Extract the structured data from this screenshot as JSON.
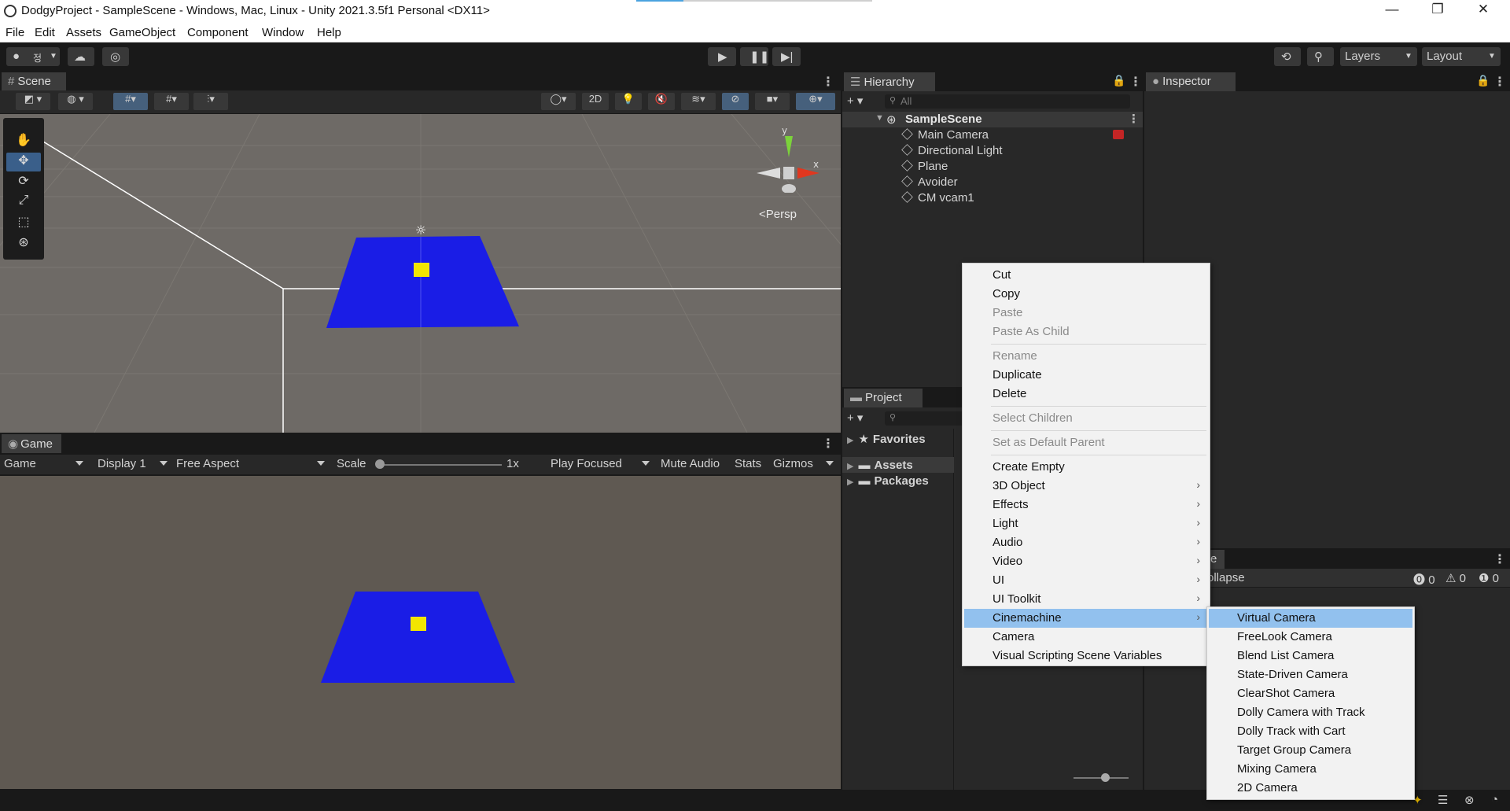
{
  "window": {
    "title": "DodgyProject - SampleScene - Windows, Mac, Linux - Unity 2021.3.5f1 Personal <DX11>",
    "minimize": "—",
    "restore": "❐",
    "close": "✕"
  },
  "menubar": [
    "File",
    "Edit",
    "Assets",
    "GameObject",
    "Component",
    "Window",
    "Help"
  ],
  "toolbar": {
    "account_glyph": "정",
    "layers": "Layers",
    "layout": "Layout"
  },
  "scene": {
    "tab": "Scene",
    "toggle_2d": "2D",
    "persp": "<Persp",
    "axis_x": "x",
    "axis_y": "y"
  },
  "game": {
    "tab": "Game",
    "mode": "Game",
    "display": "Display 1",
    "aspect": "Free Aspect",
    "scale_label": "Scale",
    "scale_value": "1x",
    "play_focused": "Play Focused",
    "mute_audio": "Mute Audio",
    "stats": "Stats",
    "gizmos": "Gizmos"
  },
  "hierarchy": {
    "tab": "Hierarchy",
    "search_placeholder": "All",
    "scene_name": "SampleScene",
    "items": [
      "Main Camera",
      "Directional Light",
      "Plane",
      "Avoider",
      "CM vcam1"
    ]
  },
  "inspector": {
    "tab": "Inspector"
  },
  "project": {
    "tab": "Project",
    "favorites": "Favorites",
    "assets": "Assets",
    "packages": "Packages"
  },
  "console": {
    "collapse": "ollapse",
    "count_errors": "0",
    "count_warnings": "0",
    "count_info": "0",
    "tab_partial": "e"
  },
  "context_menu": {
    "items": [
      {
        "label": "Cut",
        "disabled": false
      },
      {
        "label": "Copy",
        "disabled": false
      },
      {
        "label": "Paste",
        "disabled": true
      },
      {
        "label": "Paste As Child",
        "disabled": true
      },
      {
        "label": "Rename",
        "disabled": true
      },
      {
        "label": "Duplicate",
        "disabled": false
      },
      {
        "label": "Delete",
        "disabled": false
      },
      {
        "label": "Select Children",
        "disabled": true
      },
      {
        "label": "Set as Default Parent",
        "disabled": true
      },
      {
        "label": "Create Empty",
        "disabled": false
      },
      {
        "label": "3D Object",
        "disabled": false,
        "submenu": true
      },
      {
        "label": "Effects",
        "disabled": false,
        "submenu": true
      },
      {
        "label": "Light",
        "disabled": false,
        "submenu": true
      },
      {
        "label": "Audio",
        "disabled": false,
        "submenu": true
      },
      {
        "label": "Video",
        "disabled": false,
        "submenu": true
      },
      {
        "label": "UI",
        "disabled": false,
        "submenu": true
      },
      {
        "label": "UI Toolkit",
        "disabled": false,
        "submenu": true
      },
      {
        "label": "Cinemachine",
        "disabled": false,
        "submenu": true,
        "highlighted": true
      },
      {
        "label": "Camera",
        "disabled": false
      },
      {
        "label": "Visual Scripting Scene Variables",
        "disabled": false
      }
    ],
    "submenu_arrow": "›"
  },
  "cinemachine_submenu": [
    "Virtual Camera",
    "FreeLook Camera",
    "Blend List Camera",
    "State-Driven Camera",
    "ClearShot Camera",
    "Dolly Camera with Track",
    "Dolly Track with Cart",
    "Target Group Camera",
    "Mixing Camera",
    "2D Camera"
  ],
  "colors": {
    "plane": "#1a1de6",
    "cube": "#f2e600",
    "menu_highlight": "#92c1ee",
    "scene_bg": "#6e6a66",
    "game_bg": "#5f5952"
  }
}
